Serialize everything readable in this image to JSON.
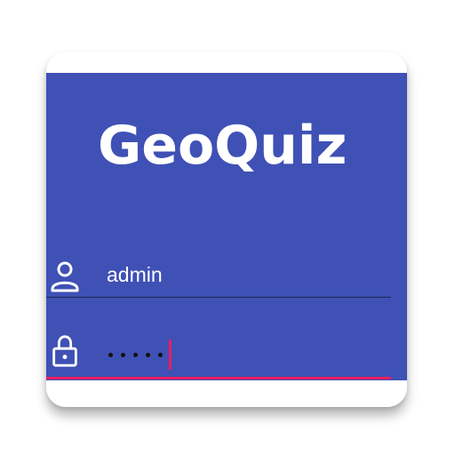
{
  "app": {
    "title": "GeoQuiz"
  },
  "login": {
    "username": {
      "value": "admin",
      "icon": "person-icon"
    },
    "password": {
      "masked_length": 5,
      "icon": "lock-icon",
      "focused": true
    }
  },
  "colors": {
    "primary": "#3f51b5",
    "accent": "#e91e63",
    "text_on_primary": "#ffffff"
  }
}
